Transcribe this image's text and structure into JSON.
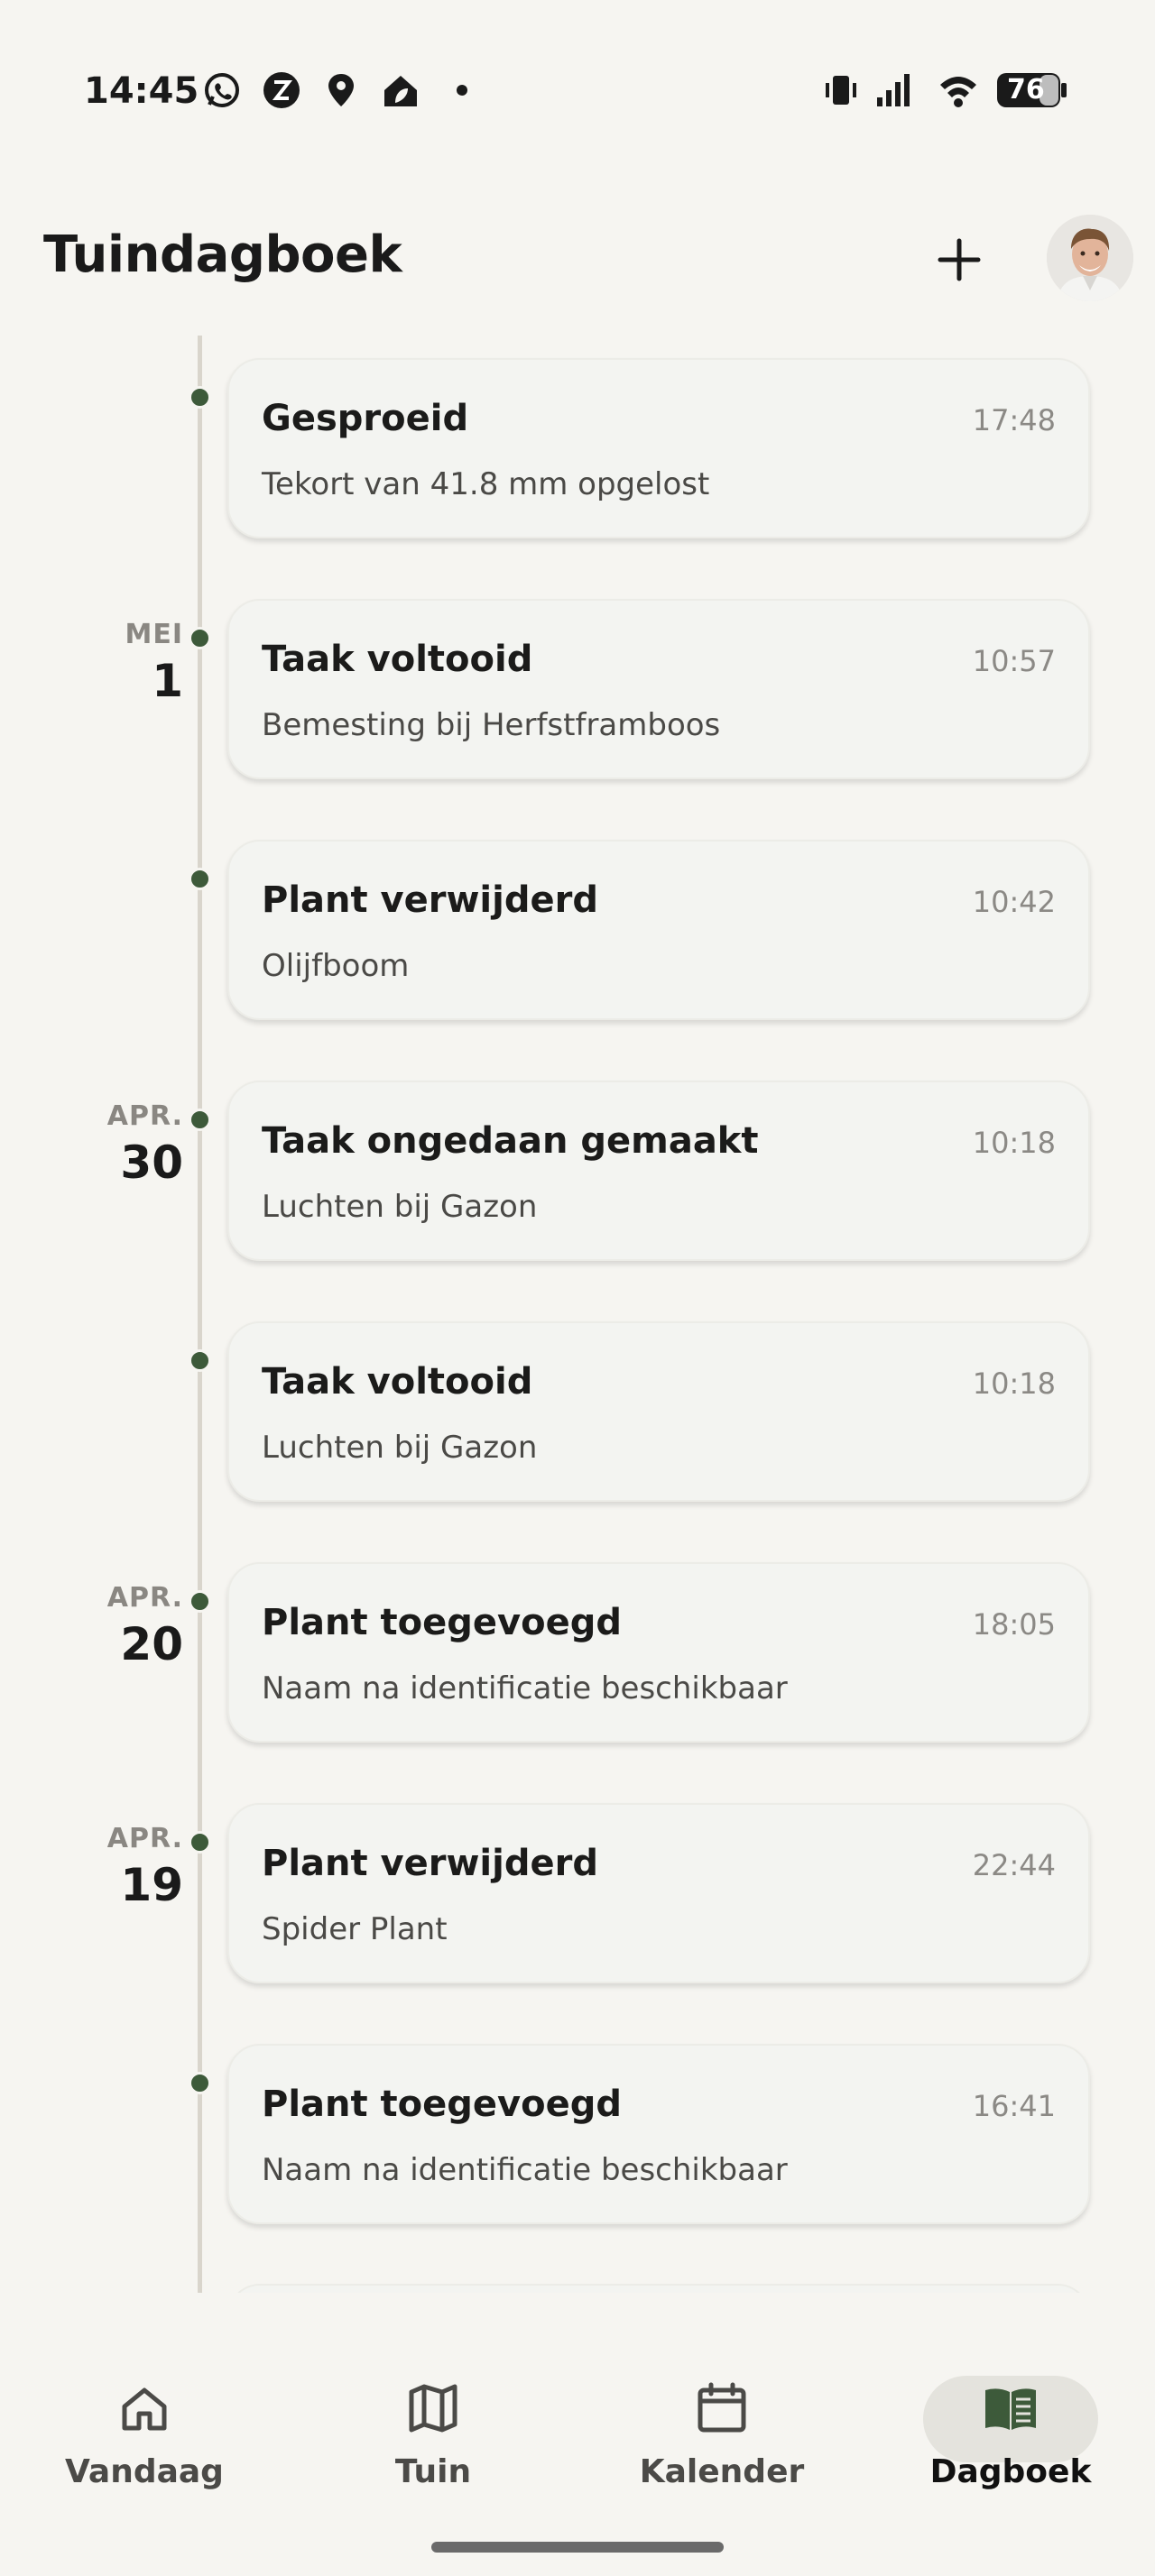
{
  "status_bar": {
    "time": "14:45",
    "icons_left": [
      "whatsapp-icon",
      "zeta-app-icon",
      "location-pin-icon",
      "home-app-icon",
      "notification-dot-icon"
    ],
    "icons_right": [
      "vibrate-icon",
      "signal-icon",
      "wifi-icon"
    ],
    "battery": "76"
  },
  "header": {
    "title": "Tuindagboek",
    "add_icon": "plus-icon",
    "avatar_icon": "user-avatar"
  },
  "colors": {
    "background": "#f6f5f1",
    "card": "#f3f4f1",
    "accent_green": "#3d5a3a",
    "timeline_line": "#d9d5cc",
    "active_pill": "#e4e3dd"
  },
  "entries": [
    {
      "month": "",
      "day": "",
      "title": "Gesproeid",
      "time": "17:48",
      "subtitle": "Tekort van 41.8 mm opgelost"
    },
    {
      "month": "MEI",
      "day": "1",
      "title": "Taak voltooid",
      "time": "10:57",
      "subtitle": "Bemesting bij Herfstframboos"
    },
    {
      "month": "",
      "day": "",
      "title": "Plant verwijderd",
      "time": "10:42",
      "subtitle": "Olijfboom"
    },
    {
      "month": "APR.",
      "day": "30",
      "title": "Taak ongedaan gemaakt",
      "time": "10:18",
      "subtitle": "Luchten bij Gazon"
    },
    {
      "month": "",
      "day": "",
      "title": "Taak voltooid",
      "time": "10:18",
      "subtitle": "Luchten bij Gazon"
    },
    {
      "month": "APR.",
      "day": "20",
      "title": "Plant toegevoegd",
      "time": "18:05",
      "subtitle": "Naam na identificatie beschikbaar"
    },
    {
      "month": "APR.",
      "day": "19",
      "title": "Plant verwijderd",
      "time": "22:44",
      "subtitle": "Spider Plant"
    },
    {
      "month": "",
      "day": "",
      "title": "Plant toegevoegd",
      "time": "16:41",
      "subtitle": "Naam na identificatie beschikbaar"
    }
  ],
  "bottom_nav": {
    "items": [
      {
        "label": "Vandaag",
        "icon": "home-icon",
        "active": false
      },
      {
        "label": "Tuin",
        "icon": "map-icon",
        "active": false
      },
      {
        "label": "Kalender",
        "icon": "calendar-icon",
        "active": false
      },
      {
        "label": "Dagboek",
        "icon": "book-icon",
        "active": true
      }
    ]
  }
}
